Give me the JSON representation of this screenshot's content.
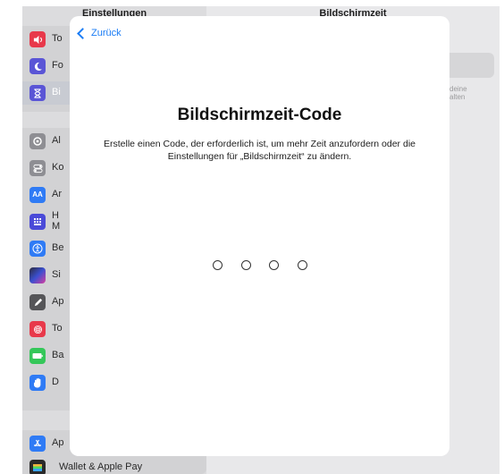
{
  "sidebar": {
    "header": "Einstellungen",
    "items": [
      {
        "icon": "speaker-icon",
        "label": "To",
        "color": "#e8394b"
      },
      {
        "icon": "moon-icon",
        "label": "Fo",
        "color": "#5a55d6"
      },
      {
        "icon": "hourglass-icon",
        "label": "Bi",
        "color": "#5a55d6",
        "selected": true
      },
      {
        "icon": "gear-icon",
        "label": "Al",
        "color": "#8e8e93"
      },
      {
        "icon": "toggle-icon",
        "label": "Ko",
        "color": "#8e8e93"
      },
      {
        "icon": "text-size-icon",
        "label": "Ar",
        "color": "#2f7bf5"
      },
      {
        "icon": "home-screen-icon",
        "label": "H",
        "label2": "M",
        "color": "#4a4ad8"
      },
      {
        "icon": "accessibility-icon",
        "label": "Be",
        "color": "#2f7bf5"
      },
      {
        "icon": "siri-icon",
        "label": "Si",
        "color": "#2a2a3a"
      },
      {
        "icon": "pencil-icon",
        "label": "Ap",
        "color": "#555558"
      },
      {
        "icon": "fingerprint-icon",
        "label": "To",
        "color": "#e8394b"
      },
      {
        "icon": "battery-icon",
        "label": "Ba",
        "color": "#34c759"
      },
      {
        "icon": "privacy-hand-icon",
        "label": "D",
        "color": "#2f7bf5"
      },
      {
        "icon": "app-store-icon",
        "label": "Ap",
        "color": "#2f7bf5"
      },
      {
        "icon": "wallet-icon",
        "label": "Wallet & Apple Pay",
        "color": "#2a2a2a"
      }
    ]
  },
  "detail": {
    "header": "Bildschirmzeit",
    "snippet": "deine\nalten"
  },
  "sheet": {
    "back_label": "Zurück",
    "title": "Bildschirmzeit-Code",
    "description": "Erstelle einen Code, der erforderlich ist, um mehr Zeit anzufordern oder die Einstellungen für „Bildschirmzeit“ zu ändern.",
    "code_length": 4
  }
}
